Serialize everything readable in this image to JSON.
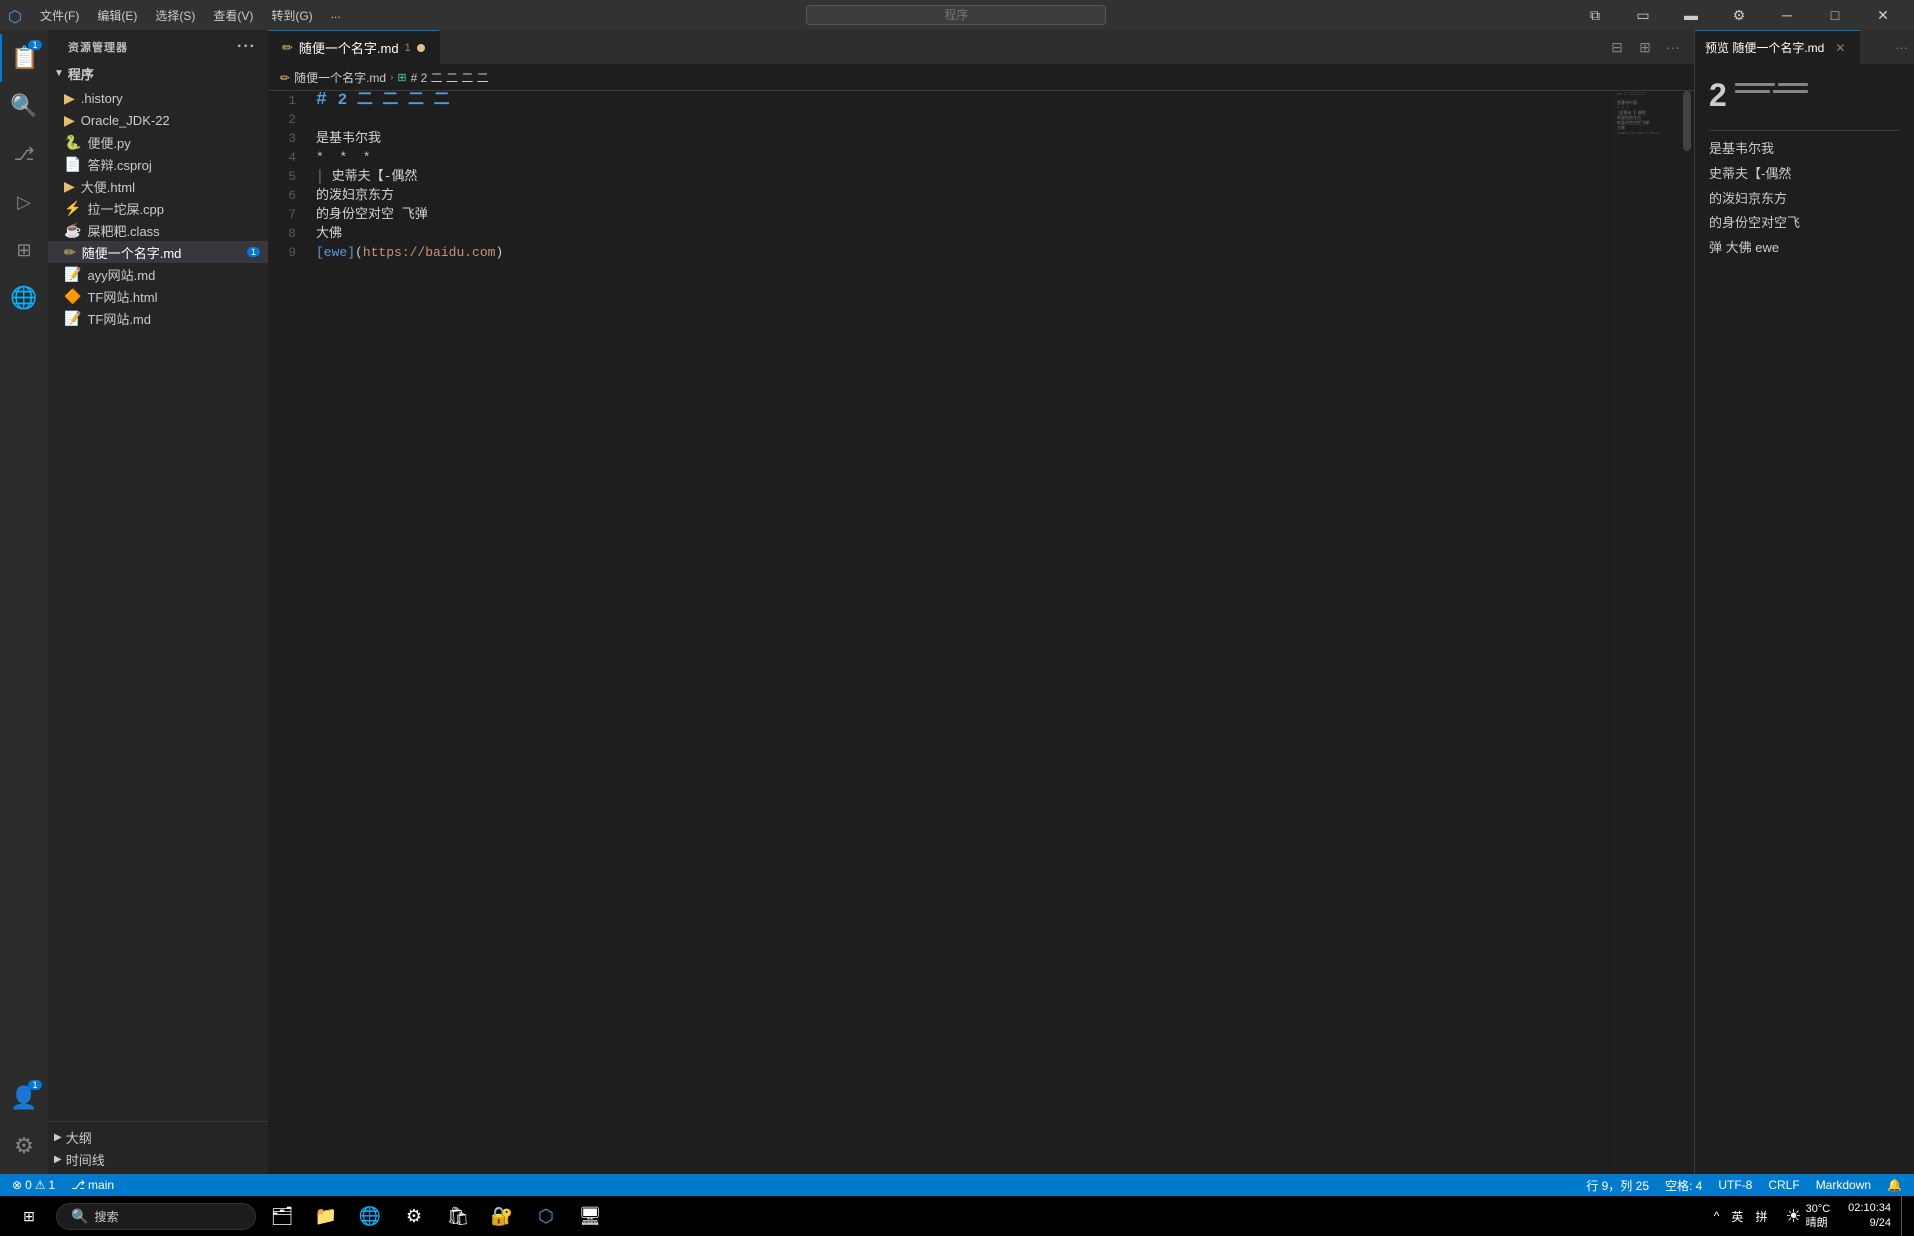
{
  "titlebar": {
    "menu_items": [
      "文件(F)",
      "编辑(E)",
      "选择(S)",
      "查看(V)",
      "转到(G)",
      "..."
    ],
    "search_placeholder": "程序",
    "title": "随便一个名字.md"
  },
  "activity_bar": {
    "items": [
      {
        "icon": "📁",
        "name": "explorer",
        "label": "资源管理器",
        "active": true,
        "badge": "1"
      },
      {
        "icon": "🔍",
        "name": "search",
        "label": "搜索"
      },
      {
        "icon": "⎇",
        "name": "source-control",
        "label": "源代码管理"
      },
      {
        "icon": "▷",
        "name": "run",
        "label": "运行和调试"
      },
      {
        "icon": "⊞",
        "name": "extensions",
        "label": "扩展"
      },
      {
        "icon": "🌐",
        "name": "remote",
        "label": "远程"
      }
    ],
    "bottom": [
      {
        "icon": "👤",
        "name": "accounts",
        "label": "账户",
        "badge": "1"
      },
      {
        "icon": "⚙",
        "name": "settings",
        "label": "设置"
      }
    ]
  },
  "sidebar": {
    "title": "资源管理器",
    "section": "程序",
    "files": [
      {
        "name": ".history",
        "icon": "▶",
        "type": "folder",
        "indent": 1
      },
      {
        "name": "Oracle_JDK-22",
        "icon": "▶",
        "type": "folder",
        "indent": 1
      },
      {
        "name": "便便.py",
        "icon": "🐍",
        "type": "file",
        "indent": 1,
        "color": "#4ec9b0"
      },
      {
        "name": "答辩.csproj",
        "icon": "📄",
        "type": "file",
        "indent": 1,
        "color": "#f0e68c"
      },
      {
        "name": "大便.html",
        "icon": "▶",
        "type": "folder-file",
        "indent": 1
      },
      {
        "name": "拉一坨屎.cpp",
        "icon": "⚡",
        "type": "file",
        "indent": 1
      },
      {
        "name": "屎粑粑.class",
        "icon": "☕",
        "type": "file",
        "indent": 1
      },
      {
        "name": "随便一个名字.md",
        "icon": "✏",
        "type": "file",
        "indent": 1,
        "active": true,
        "badge": "1"
      },
      {
        "name": "ayy网站.md",
        "icon": "📝",
        "type": "file",
        "indent": 1
      },
      {
        "name": "TF网站.html",
        "icon": "🔶",
        "type": "file",
        "indent": 1
      },
      {
        "name": "TF网站.md",
        "icon": "📝",
        "type": "file",
        "indent": 1
      }
    ],
    "footer": [
      {
        "name": "大纲",
        "icon": "▶"
      },
      {
        "name": "时间线",
        "icon": "▶"
      }
    ]
  },
  "editor": {
    "tab_label": "随便一个名字.md",
    "tab_number": "1",
    "breadcrumbs": [
      "随便一个名字.md",
      "# 2 二 二 二 二"
    ],
    "lines": [
      {
        "num": 1,
        "content": "# 2 二 二 二 二",
        "type": "h2"
      },
      {
        "num": 2,
        "content": "",
        "type": "normal"
      },
      {
        "num": 3,
        "content": "是基韦尔我",
        "type": "normal"
      },
      {
        "num": 4,
        "content": "* * *",
        "type": "bold"
      },
      {
        "num": 5,
        "content": "│ 史蒂夫【-偶然",
        "type": "blockquote"
      },
      {
        "num": 6,
        "content": "的泼妇京东方",
        "type": "normal"
      },
      {
        "num": 7,
        "content": "的身份空对空 飞弹",
        "type": "normal"
      },
      {
        "num": 8,
        "content": "大佛",
        "type": "normal"
      },
      {
        "num": 9,
        "content": "[ewe](https://baidu.com)",
        "type": "link"
      }
    ],
    "cursor": {
      "line": 9,
      "col": 25
    },
    "encoding": "UTF-8",
    "line_ending": "CRLF",
    "language": "Markdown",
    "indent": "空格: 4",
    "position": "行 9，列 25"
  },
  "preview": {
    "tab_label": "预览 随便一个名字.md",
    "h2_num": "2",
    "h2_lines": [
      40,
      30,
      20,
      25
    ],
    "body_lines": [
      "是基韦尔我",
      "",
      "史蒂夫【-偶然",
      "的泼妇京东方",
      "的身份空对空飞",
      "弹 大佛 ewe"
    ]
  },
  "status_bar": {
    "errors": "0",
    "warnings": "1",
    "branch": "main",
    "position": "行 9，列 25",
    "indent": "空格: 4",
    "encoding": "UTF-8",
    "line_ending": "CRLF",
    "language": "Markdown",
    "notification_icon": "🔔"
  },
  "taskbar": {
    "start_icon": "⊞",
    "search_placeholder": "搜索",
    "tray_icons": [
      "^",
      "英",
      "拼"
    ],
    "weather": "30°C",
    "weather_label": "晴朗",
    "clock_time": "02:10:34",
    "clock_date": "9/24"
  }
}
